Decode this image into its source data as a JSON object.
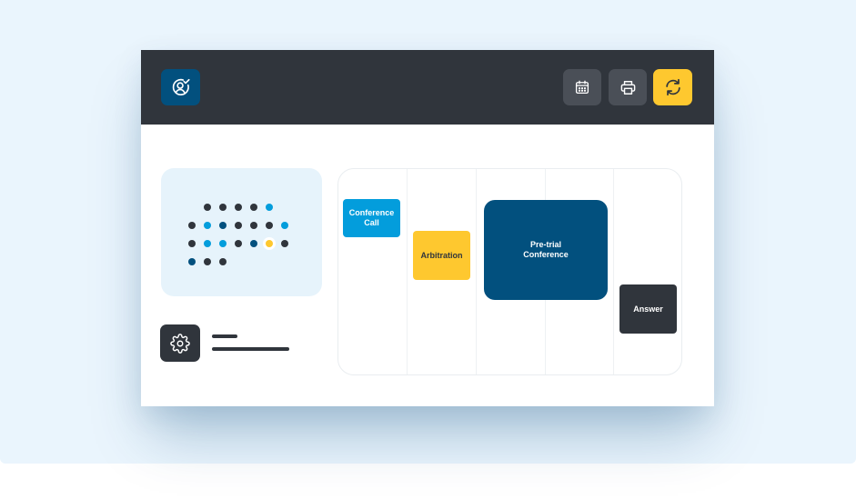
{
  "colors": {
    "background": "#eaf5fd",
    "header": "#30353c",
    "brand_blue": "#02507e",
    "light_blue": "#039ddc",
    "yellow": "#fec82f",
    "dark": "#30353c",
    "gray_button": "#4a4f57"
  },
  "header": {
    "logo_icon": "user-check-icon",
    "buttons": [
      {
        "icon": "calendar-icon"
      },
      {
        "icon": "printer-icon"
      },
      {
        "icon": "refresh-icon",
        "active": true
      }
    ]
  },
  "dot_grid": {
    "columns": 6,
    "rows": [
      [
        "",
        "",
        "dark",
        "dark",
        "dark",
        "dark",
        "blue"
      ],
      [
        "",
        "dark",
        "blue",
        "navy",
        "dark",
        "dark",
        "dark",
        "blue"
      ],
      [
        "",
        "dark",
        "blue",
        "blue",
        "dark",
        "navy",
        "yellow",
        "dark"
      ],
      [
        "",
        "navy",
        "dark",
        "dark"
      ]
    ]
  },
  "settings": {
    "icon": "gear-icon"
  },
  "timeline": {
    "columns": 5,
    "events": [
      {
        "label": "Conference\nCall",
        "color": "light_blue"
      },
      {
        "label": "Arbitration",
        "color": "yellow"
      },
      {
        "label": "Pre-trial\nConference",
        "color": "brand_blue"
      },
      {
        "label": "Answer",
        "color": "dark"
      }
    ]
  }
}
